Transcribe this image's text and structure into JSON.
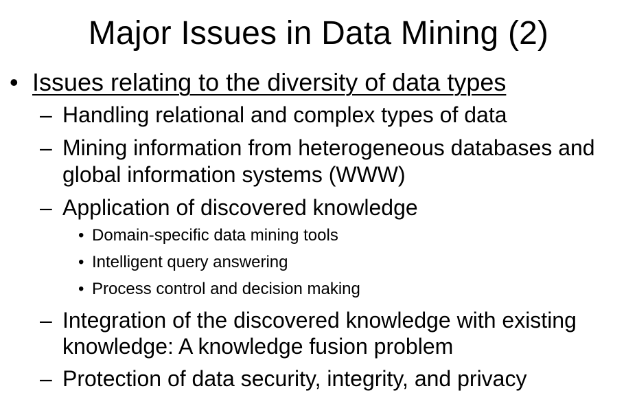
{
  "title": "Major Issues in Data Mining (2)",
  "section": {
    "bullet": "•",
    "heading": "Issues relating to the diversity of data types"
  },
  "items": [
    {
      "marker": "–",
      "line1": "Handling relational and complex types of data"
    },
    {
      "marker": "–",
      "line1": "Mining information from heterogeneous databases and",
      "line2": "global information systems (WWW)"
    },
    {
      "marker": "–",
      "line1": "Application of discovered knowledge"
    },
    {
      "marker": "–",
      "line1": "Integration of the discovered knowledge with existing",
      "line2": "knowledge: A knowledge fusion problem"
    },
    {
      "marker": "–",
      "line1": "Protection of data security, integrity, and privacy"
    }
  ],
  "subitems": [
    {
      "marker": "•",
      "text": "Domain-specific data mining tools"
    },
    {
      "marker": "•",
      "text": "Intelligent query answering"
    },
    {
      "marker": "•",
      "text": "Process control and decision making"
    }
  ]
}
